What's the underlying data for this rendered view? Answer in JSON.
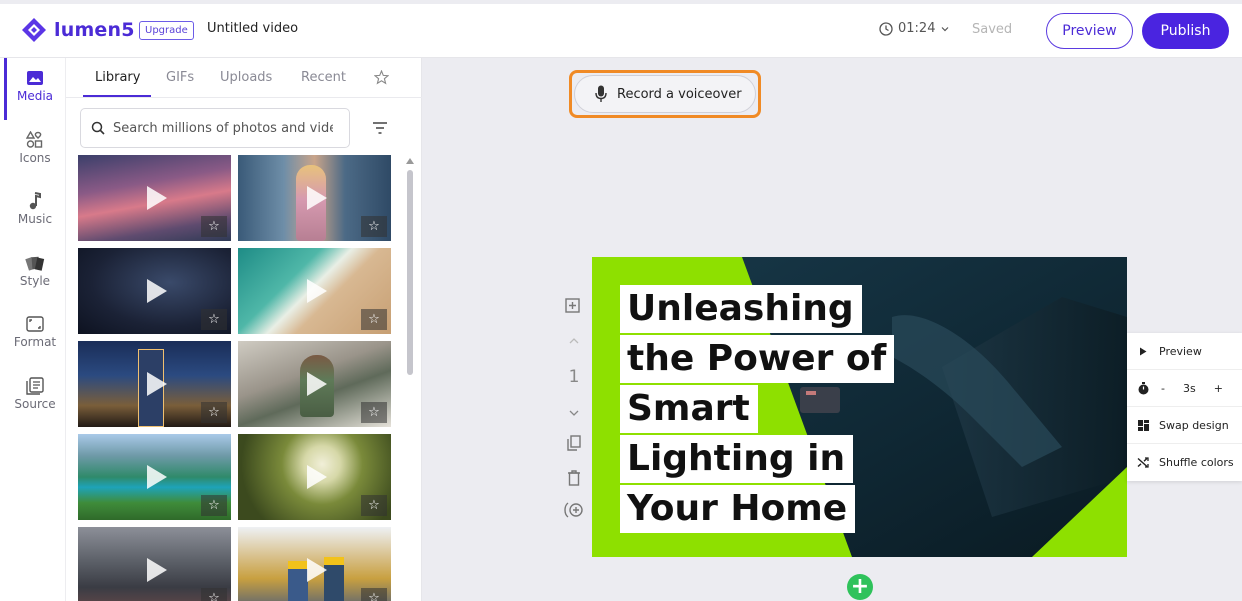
{
  "app": {
    "brand": "lumen5",
    "upgrade_label": "Upgrade",
    "title": "Untitled video",
    "duration": "01:24",
    "save_status": "Saved",
    "preview_label": "Preview",
    "publish_label": "Publish",
    "accent_color": "#4a24e0"
  },
  "rail": {
    "items": [
      {
        "label": "Media",
        "icon": "image-icon",
        "active": true
      },
      {
        "label": "Icons",
        "icon": "shapes-icon"
      },
      {
        "label": "Music",
        "icon": "music-note-icon"
      },
      {
        "label": "Style",
        "icon": "palette-icon"
      },
      {
        "label": "Format",
        "icon": "aspect-ratio-icon"
      },
      {
        "label": "Source",
        "icon": "document-icon"
      }
    ]
  },
  "media_panel": {
    "tabs": [
      "Library",
      "GIFs",
      "Uploads",
      "Recent"
    ],
    "active_tab": "Library",
    "search_placeholder": "Search millions of photos and videos",
    "thumbnails": [
      {
        "subject": "pink sunset clouds"
      },
      {
        "subject": "woman using phone in station"
      },
      {
        "subject": "rain on dark surface"
      },
      {
        "subject": "aerial beach waves"
      },
      {
        "subject": "city skyline at dusk"
      },
      {
        "subject": "man on video call at desk"
      },
      {
        "subject": "aerial river valley"
      },
      {
        "subject": "white dandelion flower"
      },
      {
        "subject": "busy city intersection"
      },
      {
        "subject": "construction workers"
      }
    ]
  },
  "canvas": {
    "voiceover_label": "Record a voiceover",
    "scene_number": "1",
    "slide_lines": [
      "Unleashing",
      "the Power of",
      "Smart",
      "Lighting in",
      "Your Home"
    ],
    "slide_accent_color": "#8ee000"
  },
  "scene_menu": {
    "preview_label": "Preview",
    "decrease_label": "-",
    "duration_label": "3s",
    "increase_label": "+",
    "swap_label": "Swap design",
    "shuffle_label": "Shuffle colors"
  }
}
